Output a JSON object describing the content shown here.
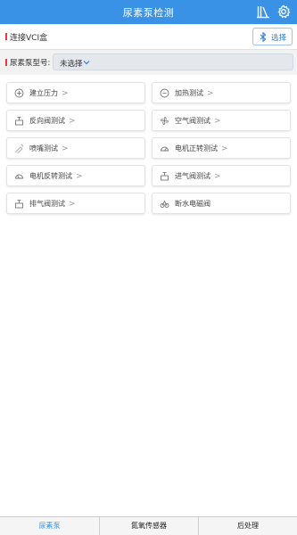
{
  "header": {
    "title": "尿素泵检测",
    "icons": [
      "library-icon",
      "gear-icon"
    ]
  },
  "vci": {
    "label": "连接VCI盒",
    "button_label": "选择",
    "button_icon": "bluetooth-icon"
  },
  "model": {
    "label": "尿素泵型号:",
    "value": "未选择"
  },
  "tests": [
    {
      "label": "建立压力",
      "icon": "pressure-icon"
    },
    {
      "label": "加热测试",
      "icon": "heat-icon"
    },
    {
      "label": "反向阀测试",
      "icon": "valve-icon"
    },
    {
      "label": "空气阀测试",
      "icon": "fan-icon"
    },
    {
      "label": "喷嘴测试",
      "icon": "nozzle-icon"
    },
    {
      "label": "电机正转测试",
      "icon": "gauge-icon"
    },
    {
      "label": "电机反转测试",
      "icon": "gauge-icon"
    },
    {
      "label": "进气阀测试",
      "icon": "valve-icon"
    },
    {
      "label": "排气阀测试",
      "icon": "valve-icon"
    },
    {
      "label": "断水电磁阀",
      "icon": "solenoid-icon"
    }
  ],
  "arrow": ">",
  "tabs": [
    {
      "label": "尿素泵",
      "active": true
    },
    {
      "label": "氮氧传感器",
      "active": false
    },
    {
      "label": "后处理",
      "active": false
    }
  ],
  "colors": {
    "accent": "#3a92e6",
    "marker": "#e23d3d",
    "background": "#f2f2f2"
  }
}
